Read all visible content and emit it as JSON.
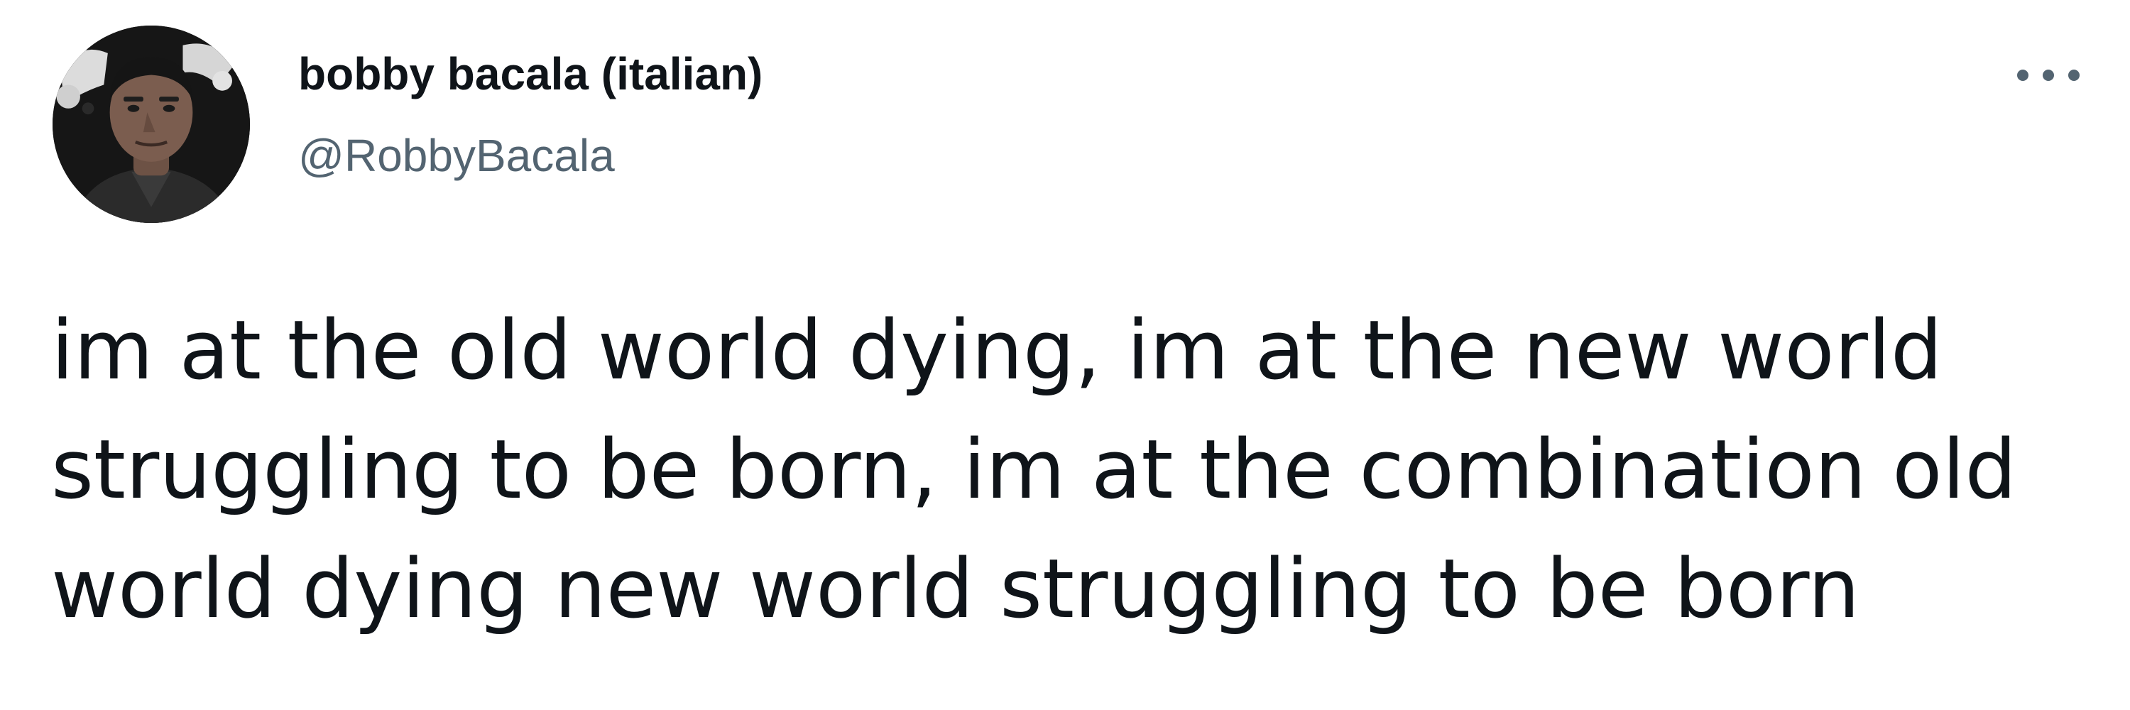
{
  "tweet": {
    "author": {
      "display_name": "bobby bacala (italian)",
      "handle": "@RobbyBacala",
      "avatar_icon": "profile-photo"
    },
    "more_icon": "more-options-icon",
    "text": "im at the old world dying, im at the new world\nstruggling to be born, im at the combination old\nworld dying new world struggling to be born"
  },
  "colors": {
    "text_primary": "#0f1419",
    "text_secondary": "#536471",
    "background": "#ffffff"
  }
}
